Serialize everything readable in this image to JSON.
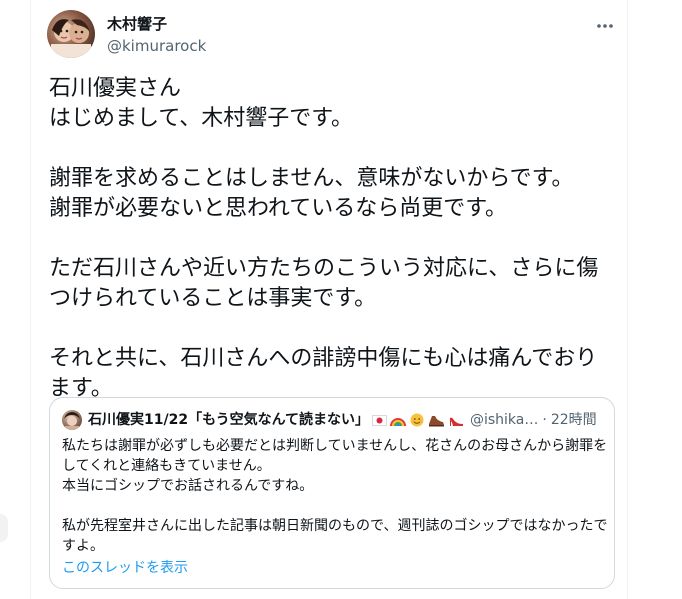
{
  "author": {
    "display_name": "木村響子",
    "handle": "@kimurarock"
  },
  "tweet": {
    "text": "石川優実さん\nはじめまして、木村響子です。\n\n謝罪を求めることはしません、意味がないからです。\n謝罪が必要ないと思われているなら尚更です。\n\nただ石川さんや近い方たちのこういう対応に、さらに傷つけられていることは事実です。\n\nそれと共に、石川さんへの誹謗中傷にも心は痛んでおります。"
  },
  "quoted": {
    "display_name": "石川優実11/22「もう空気なんて読まない」",
    "emojis": [
      "japan-flag-icon",
      "rainbow-icon",
      "smiling-sun-icon",
      "brown-shoe-icon",
      "red-high-heel-icon"
    ],
    "handle": "@ishika…",
    "separator": "·",
    "time": "22時間",
    "text": "私たちは謝罪が必ずしも必要だとは判断していませんし、花さんのお母さんから謝罪をしてくれと連絡もきていません。\n本当にゴシップでお話されるんですね。\n\n私が先程室井さんに出した記事は朝日新聞のもので、週刊誌のゴシップではなかったですよ。",
    "show_thread": "このスレッドを表示"
  },
  "colors": {
    "text_primary": "#0f1419",
    "text_secondary": "#536471",
    "link": "#1d9bf0",
    "border": "#cfd9de"
  }
}
